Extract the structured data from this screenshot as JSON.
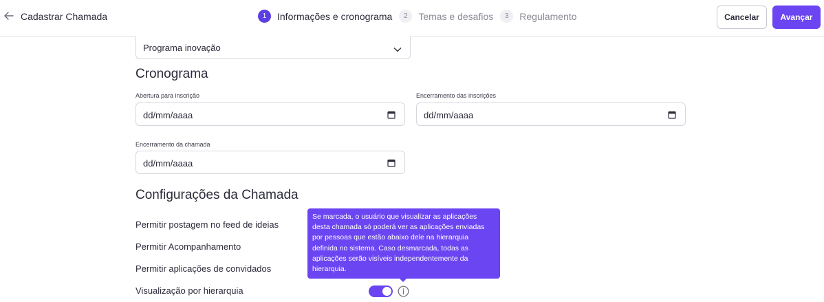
{
  "header": {
    "title": "Cadastrar Chamada",
    "steps": [
      {
        "number": "1",
        "label": "Informações e cronograma",
        "active": true
      },
      {
        "number": "2",
        "label": "Temas e desafios",
        "active": false
      },
      {
        "number": "3",
        "label": "Regulamento",
        "active": false
      }
    ],
    "cancel_label": "Cancelar",
    "next_label": "Avançar"
  },
  "program_select": {
    "value": "Programa inovação"
  },
  "schedule": {
    "title": "Cronograma",
    "fields": [
      {
        "label": "Abertura para inscrição",
        "value": "dd/mm/aaaa"
      },
      {
        "label": "Encerramento das inscrições",
        "value": "dd/mm/aaaa"
      },
      {
        "label": "Encerramento da chamada",
        "value": "dd/mm/aaaa"
      }
    ]
  },
  "settings": {
    "title": "Configurações da Chamada",
    "options": [
      {
        "label": "Permitir postagem no feed de ideias"
      },
      {
        "label": "Permitir Acompanhamento"
      },
      {
        "label": "Permitir aplicações de convidados"
      },
      {
        "label": "Visualização por hierarquia",
        "enabled": true
      }
    ],
    "tooltip": "Se marcada, o usuário que visualizar as aplicações desta chamada só poderá ver as aplicações enviadas por pessoas que estão abaixo dele na hierarquia definida no sistema. Caso desmarcada, todas as aplicações serão visíveis independentemente da hierarquia."
  },
  "colors": {
    "accent": "#6b45f2",
    "step_active": "#5b3fe0"
  },
  "icons": {
    "back": "arrow-left-icon",
    "chevron": "chevron-down-icon",
    "calendar": "calendar-icon",
    "info": "info-icon"
  }
}
